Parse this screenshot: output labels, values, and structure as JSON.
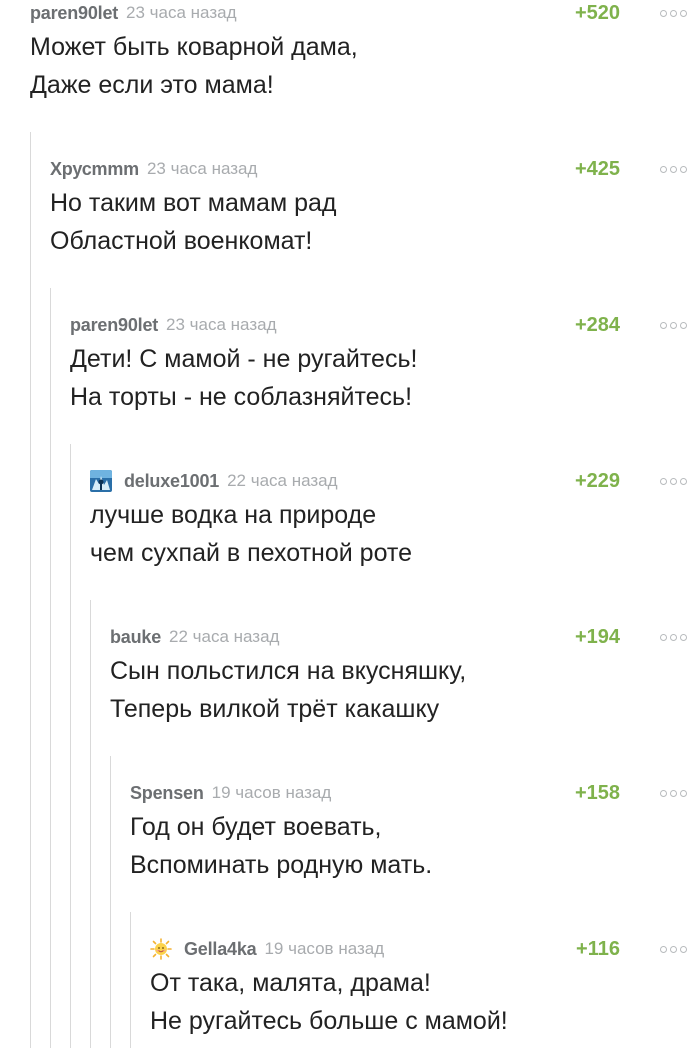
{
  "comments": [
    {
      "author": "paren90let",
      "time": "23 часа назад",
      "rating": "+520",
      "lines": [
        "Может быть коварной дама,",
        "Даже если это мама!"
      ]
    },
    {
      "author": "Хрусmmm",
      "time": "23 часа назад",
      "rating": "+425",
      "lines": [
        "Но таким вот мамам рад",
        "Областной военкомат!"
      ]
    },
    {
      "author": "paren90let",
      "time": "23 часа назад",
      "rating": "+284",
      "lines": [
        "Дети! С мамой - не ругайтесь!",
        "На торты - не соблазняйтесь!"
      ]
    },
    {
      "author": "deluxe1001",
      "time": "22 часа назад",
      "rating": "+229",
      "avatar": "deluxe-avatar",
      "lines": [
        "лучше водка на природе",
        "чем сухпай в пехотной роте"
      ]
    },
    {
      "author": "bauke",
      "time": "22 часа назад",
      "rating": "+194",
      "lines": [
        "Сын польстился на вкусняшку,",
        "Теперь вилкой трёт какашку"
      ]
    },
    {
      "author": "Spensen",
      "time": "19 часов назад",
      "rating": "+158",
      "lines": [
        "Год он будет воевать,",
        "Вспоминать родную мать."
      ]
    },
    {
      "author": "Gella4ka",
      "time": "19 часов назад",
      "rating": "+116",
      "avatar": "gella-avatar",
      "lines": [
        "От така, малята, драма!",
        "Не ругайтесь больше с мамой!"
      ]
    }
  ],
  "colors": {
    "rating": "#7fb24c",
    "author": "#6c6f72",
    "time": "#a8abae",
    "text": "#222222",
    "thread_line": "#d9d9d9"
  }
}
